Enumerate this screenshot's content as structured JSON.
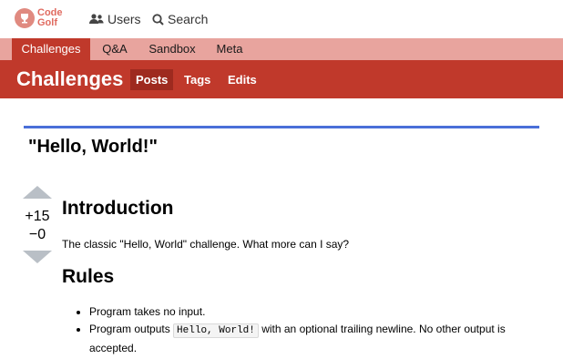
{
  "logo": {
    "line1": "Code",
    "line2": "Golf"
  },
  "topnav": {
    "users": "Users",
    "search": "Search"
  },
  "subnav": [
    "Challenges",
    "Q&A",
    "Sandbox",
    "Meta"
  ],
  "category": {
    "title": "Challenges",
    "tabs": [
      "Posts",
      "Tags",
      "Edits"
    ]
  },
  "post": {
    "title": "\"Hello, World!\"",
    "votes": {
      "up": "+15",
      "down": "−0"
    },
    "intro_heading": "Introduction",
    "intro_text": "The classic \"Hello, World\" challenge. What more can I say?",
    "rules_heading": "Rules",
    "rule1": "Program takes no input.",
    "rule2_before": "Program outputs ",
    "rule2_code": "Hello, World!",
    "rule2_after": " with an optional trailing newline. No other output is accepted."
  },
  "colors": {
    "accent": "#c0392b",
    "subnav": "#e8a49e",
    "divider": "#4a6fd8",
    "vote": "#b9bfc6"
  }
}
